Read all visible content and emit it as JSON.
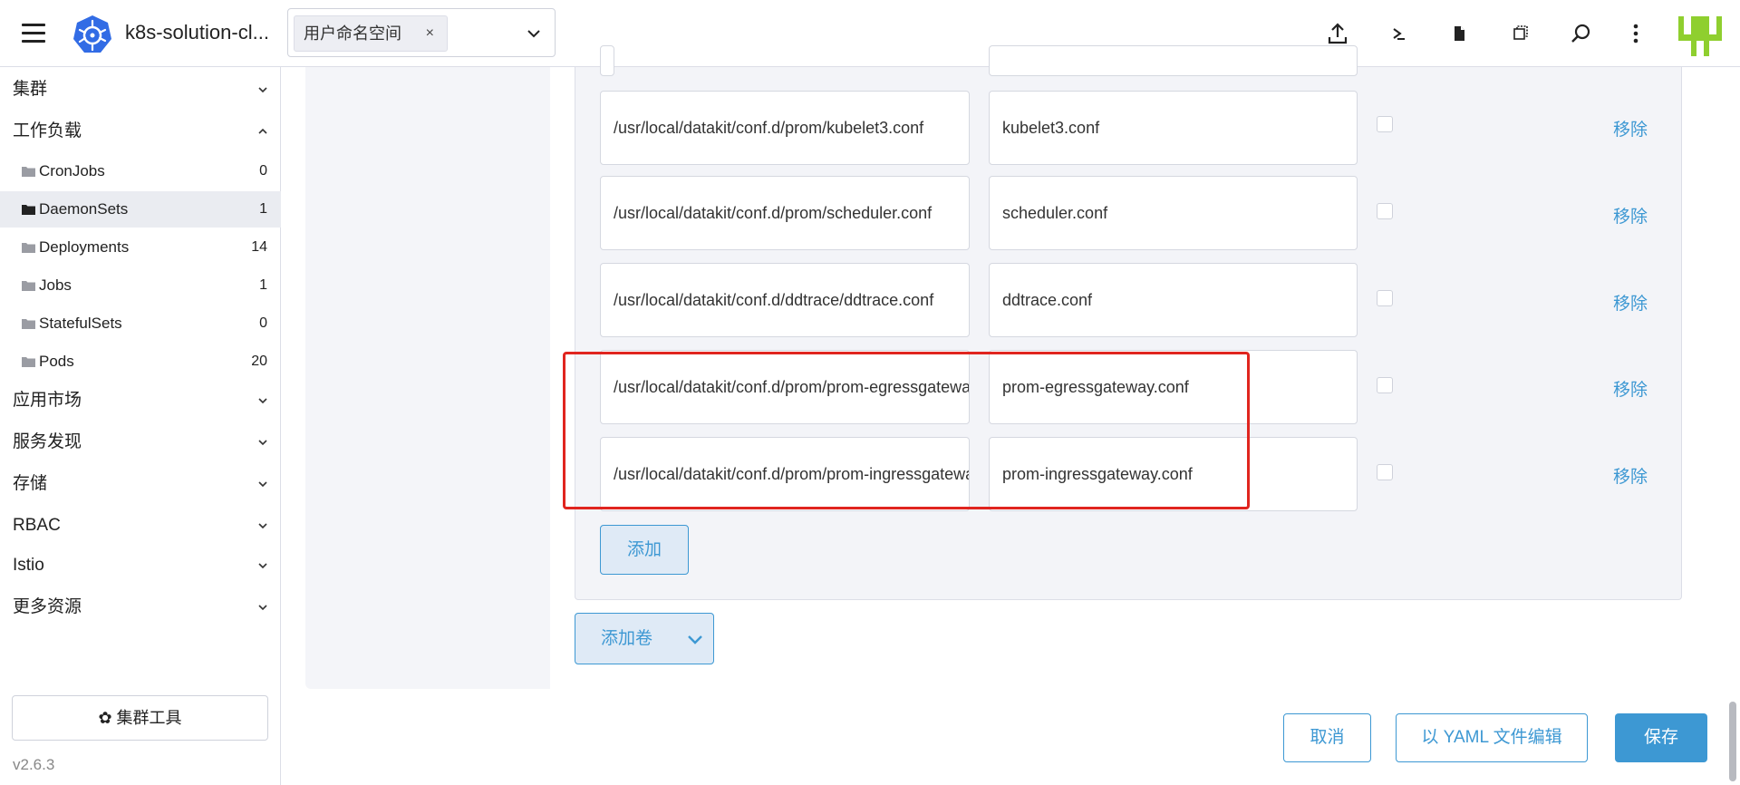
{
  "header": {
    "app_title": "k8s-solution-cl...",
    "namespace_chip": "用户命名空间",
    "chip_close": "×",
    "icons": [
      "upload-icon",
      "terminal-icon",
      "file-icon",
      "copy-icon",
      "search-icon",
      "kebab-menu-icon"
    ]
  },
  "sidebar": {
    "groups": {
      "cluster": "集群",
      "workload": "工作负载",
      "apps": "应用市场",
      "service_discovery": "服务发现",
      "storage": "存储",
      "rbac": "RBAC",
      "istio": "Istio",
      "more": "更多资源"
    },
    "items": [
      {
        "label": "CronJobs",
        "count": "0"
      },
      {
        "label": "DaemonSets",
        "count": "1"
      },
      {
        "label": "Deployments",
        "count": "14"
      },
      {
        "label": "Jobs",
        "count": "1"
      },
      {
        "label": "StatefulSets",
        "count": "0"
      },
      {
        "label": "Pods",
        "count": "20"
      }
    ],
    "cluster_tools": "集群工具",
    "version": "v2.6.3"
  },
  "rows": [
    {
      "path": "/usr/local/datakit/conf.d/prom/kubelet3.conf",
      "key": "kubelet3.conf",
      "remove": "移除"
    },
    {
      "path": "/usr/local/datakit/conf.d/prom/scheduler.conf",
      "key": "scheduler.conf",
      "remove": "移除"
    },
    {
      "path": "/usr/local/datakit/conf.d/ddtrace/ddtrace.conf",
      "key": "ddtrace.conf",
      "remove": "移除"
    },
    {
      "path": "/usr/local/datakit/conf.d/prom/prom-egressgateway.conf",
      "key": "prom-egressgateway.conf",
      "remove": "移除"
    },
    {
      "path": "/usr/local/datakit/conf.d/prom/prom-ingressgateway.conf",
      "key": "prom-ingressgateway.conf",
      "remove": "移除"
    }
  ],
  "buttons": {
    "add": "添加",
    "add_volume": "添加卷",
    "cancel": "取消",
    "edit_yaml": "以 YAML 文件编辑",
    "save": "保存"
  },
  "colors": {
    "accent": "#3d98d3",
    "highlight_border": "#e0251f",
    "logo_blue": "#326ce5",
    "avatar_green": "#8fcf2f"
  }
}
